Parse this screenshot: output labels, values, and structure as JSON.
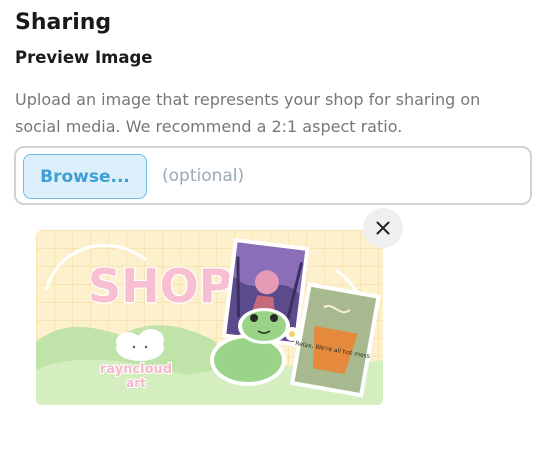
{
  "section": {
    "title": "Sharing",
    "subtitle": "Preview Image",
    "description": "Upload an image that represents your shop for sharing on social media. We recommend a 2:1 aspect ratio."
  },
  "upload": {
    "browse_label": "Browse...",
    "hint": "(optional)"
  },
  "preview": {
    "close_icon": "close-icon",
    "artwork_text": {
      "headline": "SHOP",
      "artist_line1": "rayncloud",
      "artist_line2": "art",
      "sticker_text": "Relax, We're all hot mess"
    }
  },
  "colors": {
    "browse_bg": "#ddeffb",
    "browse_border": "#6fbde6",
    "browse_text": "#3d9fd6",
    "hint_text": "#9aaab2"
  }
}
